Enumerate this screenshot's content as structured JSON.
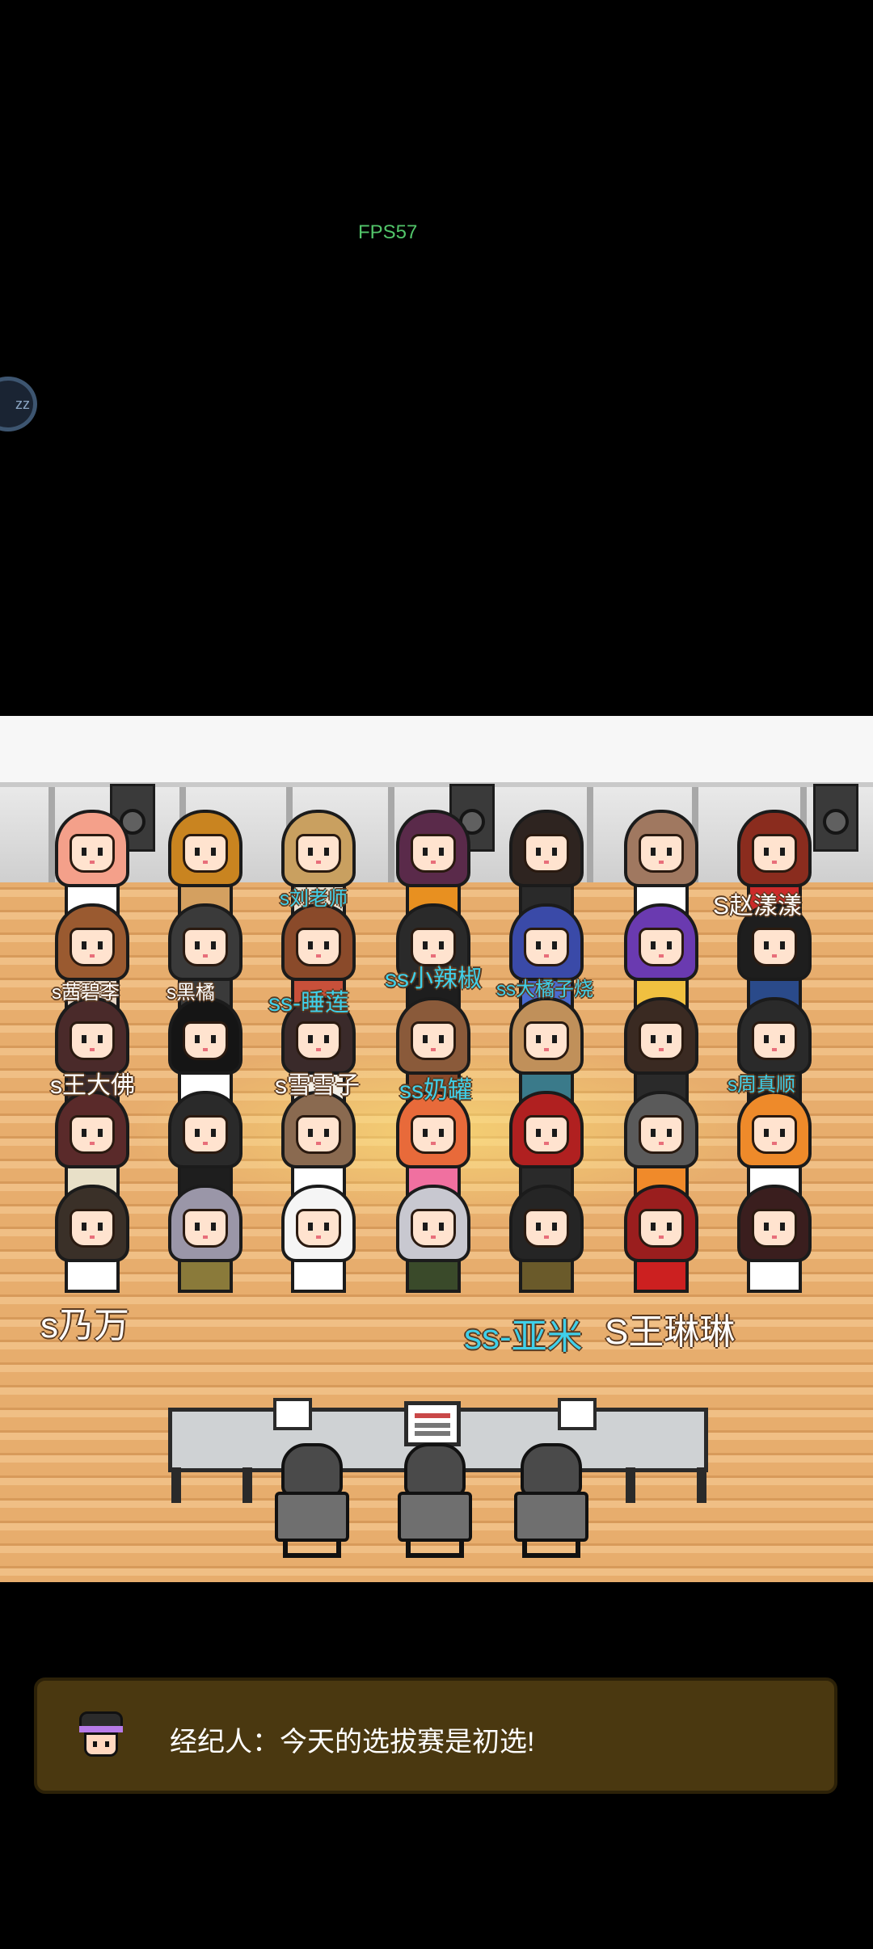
{
  "hud": {
    "fps": "FPS57",
    "side_button": "zz"
  },
  "trainees": {
    "hair_colors": [
      "#f4a08a",
      "#c98420",
      "#c9a060",
      "#5a2a4a",
      "#2e2420",
      "#a07860",
      "#8a2c1e",
      "#9a5a30",
      "#3a3a3a",
      "#8a4a2a",
      "#2a2a2a",
      "#3a4aa8",
      "#6a3ab0",
      "#1e1e1e",
      "#4a2a2a",
      "#151515",
      "#3a2a2a",
      "#8a5a3a",
      "#c0905a",
      "#3a2a22",
      "#2a2a2a",
      "#5a2a2a",
      "#2a2a2a",
      "#8a6a50",
      "#e86a3a",
      "#b02020",
      "#5a5a5a",
      "#ee8a2a",
      "#3a3028",
      "#9a96a8",
      "#f5f5f5",
      "#c8c8d0",
      "#252525",
      "#9a1e1e",
      "#3a1e1e"
    ],
    "outfit_colors": [
      "#ffffff",
      "#d4a060",
      "#e8e0d0",
      "#e89020",
      "#2a2a2a",
      "#ffffff",
      "#cc2a2a",
      "#e8d8c8",
      "#3a3a3a",
      "#c8503a",
      "#1e1e1e",
      "#4a6ad0",
      "#f0c040",
      "#2a4a8a",
      "#3a2a2a",
      "#ffffff",
      "#f4f0e8",
      "#8a4a2a",
      "#3a7a8a",
      "#2a2a2a",
      "#222222",
      "#e8e0c8",
      "#1e1e1e",
      "#ffffff",
      "#f070a0",
      "#2a2a2a",
      "#f08a2a",
      "#ffffff",
      "#ffffff",
      "#8a7a3a",
      "#ffffff",
      "#3a4a2a",
      "#6a5a2a",
      "#cc2020",
      "#ffffff"
    ]
  },
  "labels": {
    "liu_laoshi": "s刘老师",
    "zhao_yangyang": "S赵漾漾",
    "row2_a": "s茜碧李",
    "row2_b": "s黑橘",
    "shuilian": "ss-睡莲",
    "xiao_lajiao": "ss小辣椒",
    "row2_c": "ss大橘子烧",
    "wang_dafo": "s王大佛",
    "xue_xuezi": "s雪雪子",
    "naiguan": "ss奶罐",
    "zhou_zhen": "s周真顺",
    "naiwan": "s乃万",
    "yami": "ss-亚米",
    "wang_linlin": "S王琳琳"
  },
  "dialog": {
    "text": "经纪人：今天的选拔赛是初选!",
    "avatar_icon": "manager-avatar-icon"
  },
  "colors": {
    "floor": "#e7ad6d",
    "dialog_bg": "#4a3810",
    "label_cyan": "#3fd0ea",
    "fps_green": "#52c56a"
  }
}
